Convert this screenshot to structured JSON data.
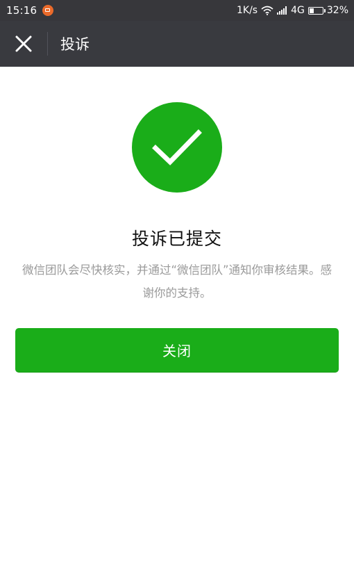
{
  "status_bar": {
    "time": "15:16",
    "net_speed": "1K/s",
    "network_type": "4G",
    "battery_percent": "32%",
    "battery_level": 0.32,
    "notification_icon": "app-notification-icon",
    "wifi_icon": "wifi-icon",
    "signal_icon": "cellular-signal-icon",
    "battery_icon": "battery-icon"
  },
  "header": {
    "close_icon": "close-icon",
    "title": "投诉"
  },
  "main": {
    "success_icon": "check-icon",
    "result_title": "投诉已提交",
    "result_desc": "微信团队会尽快核实，并通过“微信团队”通知你审核结果。感谢你的支持。",
    "close_label": "关闭"
  },
  "colors": {
    "accent_green": "#1aad19",
    "title_bar": "#393a3f",
    "status_bar": "#37373b",
    "description_gray": "#9a9a9a"
  }
}
